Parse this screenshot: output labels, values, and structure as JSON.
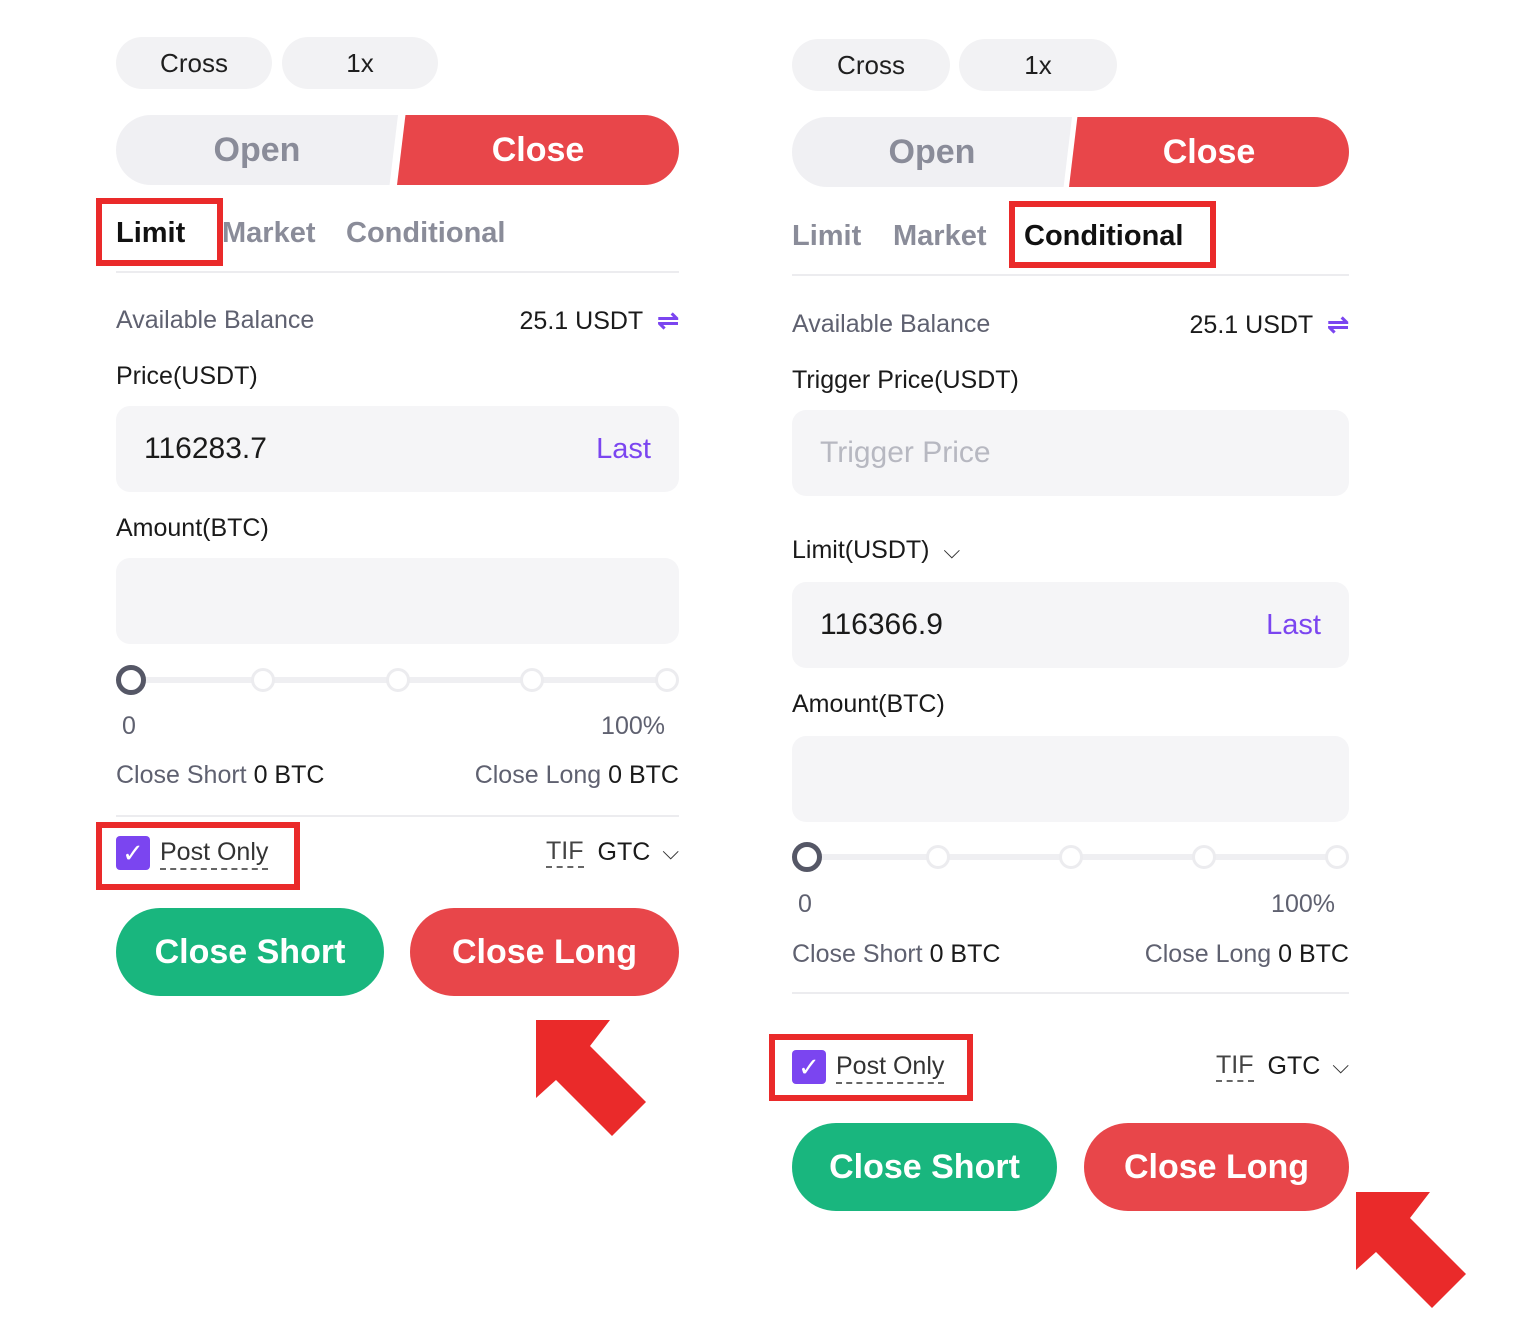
{
  "panels": [
    {
      "margin_mode": "Cross",
      "leverage": "1x",
      "open_label": "Open",
      "close_label": "Close",
      "tabs": [
        "Limit",
        "Market",
        "Conditional"
      ],
      "active_tab": "Limit",
      "balance_label": "Available Balance",
      "balance_value": "25.1 USDT",
      "swap_icon": "⇌",
      "price_label": "Price(USDT)",
      "price_value": "116283.7",
      "last_label": "Last",
      "amount_label": "Amount(BTC)",
      "slider_min": "0",
      "slider_max": "100%",
      "slider_value": 0,
      "close_short_text": "Close Short",
      "close_short_amount": "0 BTC",
      "close_long_text": "Close Long",
      "close_long_amount": "0 BTC",
      "post_only": "Post Only",
      "tif_label": "TIF",
      "tif_value": "GTC",
      "btn_close_short": "Close Short",
      "btn_close_long": "Close Long"
    },
    {
      "margin_mode": "Cross",
      "leverage": "1x",
      "open_label": "Open",
      "close_label": "Close",
      "tabs": [
        "Limit",
        "Market",
        "Conditional"
      ],
      "active_tab": "Conditional",
      "balance_label": "Available Balance",
      "balance_value": "25.1 USDT",
      "swap_icon": "⇌",
      "trigger_label": "Trigger Price(USDT)",
      "trigger_placeholder": "Trigger Price",
      "limit_label": "Limit(USDT)",
      "limit_value": "116366.9",
      "last_label": "Last",
      "amount_label": "Amount(BTC)",
      "slider_min": "0",
      "slider_max": "100%",
      "slider_value": 0,
      "close_short_text": "Close Short",
      "close_short_amount": "0 BTC",
      "close_long_text": "Close Long",
      "close_long_amount": "0 BTC",
      "post_only": "Post Only",
      "tif_label": "TIF",
      "tif_value": "GTC",
      "btn_close_short": "Close Short",
      "btn_close_long": "Close Long"
    }
  ],
  "colors": {
    "accent_purple": "#7b45f0",
    "close_red": "#e8464a",
    "short_green": "#19b67e",
    "highlight_red": "#ea2a2a"
  },
  "icons": {
    "check": "✓",
    "chevron": "⌵"
  }
}
